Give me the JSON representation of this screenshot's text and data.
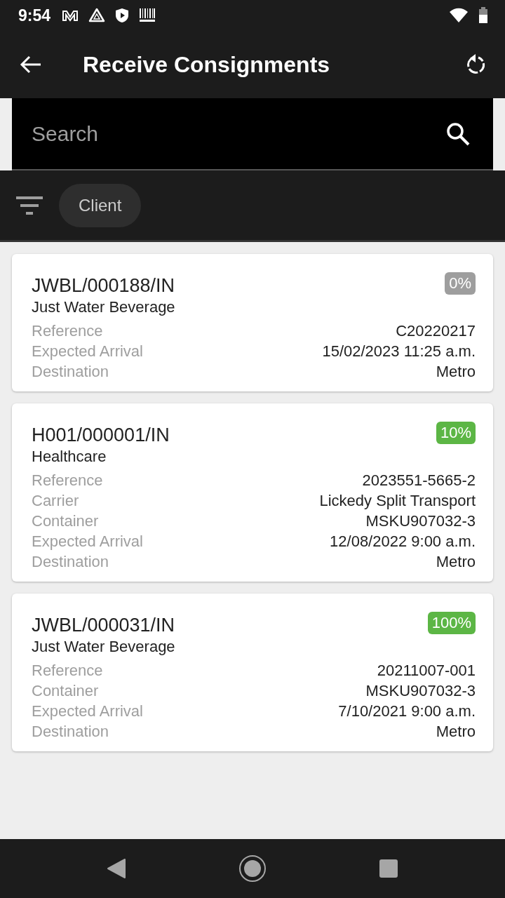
{
  "status_bar": {
    "time": "9:54"
  },
  "app_bar": {
    "title": "Receive Consignments"
  },
  "search": {
    "placeholder": "Search"
  },
  "filters": [
    {
      "label": "Client"
    }
  ],
  "consignments": [
    {
      "number": "JWBL/000188/IN",
      "client": "Just Water Beverage",
      "progress": "0%",
      "color": "#9e9e9e",
      "fields": [
        {
          "label": "Reference",
          "value": "C20220217"
        },
        {
          "label": "Expected Arrival",
          "value": "15/02/2023 11:25 a.m."
        },
        {
          "label": "Destination",
          "value": "Metro"
        }
      ]
    },
    {
      "number": "H001/000001/IN",
      "client": "Healthcare",
      "progress": "10%",
      "color": "#5cb645",
      "fields": [
        {
          "label": "Reference",
          "value": "2023551-5665-2"
        },
        {
          "label": "Carrier",
          "value": "Lickedy Split Transport"
        },
        {
          "label": "Container",
          "value": "MSKU907032-3"
        },
        {
          "label": "Expected Arrival",
          "value": "12/08/2022 9:00 a.m."
        },
        {
          "label": "Destination",
          "value": "Metro"
        }
      ]
    },
    {
      "number": "JWBL/000031/IN",
      "client": "Just Water Beverage",
      "progress": "100%",
      "color": "#5cb645",
      "fields": [
        {
          "label": "Reference",
          "value": "20211007-001"
        },
        {
          "label": "Container",
          "value": "MSKU907032-3"
        },
        {
          "label": "Expected Arrival",
          "value": "7/10/2021 9:00 a.m."
        },
        {
          "label": "Destination",
          "value": "Metro"
        }
      ]
    }
  ]
}
